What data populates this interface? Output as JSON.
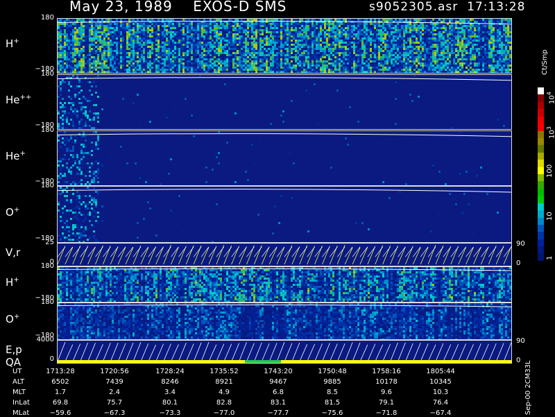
{
  "header": {
    "date": "May 23, 1989",
    "instrument": "EXOS-D SMS",
    "file": "s9052305.asr",
    "time": "17:13:28"
  },
  "chart_data": {
    "type": "heatmap",
    "panels": [
      {
        "label": "H",
        "sup": "+",
        "ymax": "180",
        "ymin": "−180",
        "intensity": 0.85
      },
      {
        "label": "He",
        "sup": "++",
        "ymax": "180",
        "ymin": "−180",
        "intensity": 0.0
      },
      {
        "label": "He",
        "sup": "+",
        "ymax": "180",
        "ymin": "−180",
        "intensity": 0.12
      },
      {
        "label": "O",
        "sup": "+",
        "ymax": "180",
        "ymin": "−180",
        "intensity": 0.1
      },
      {
        "label": "V,r",
        "sup": "",
        "ymax": "25",
        "ymin": "0",
        "right_top": "90",
        "right_bottom": "0",
        "kind": "trace"
      },
      {
        "label": "H",
        "sup": "+",
        "ymax": "180",
        "ymin": "−180",
        "intensity": 0.7
      },
      {
        "label": "O",
        "sup": "+",
        "ymax": "180",
        "ymin": "−180",
        "intensity": 0.45
      },
      {
        "label": "E,p",
        "label2": "QA",
        "sup": "",
        "ymax": "4000",
        "ymin": "0",
        "right_top": "90",
        "right_bottom": "0",
        "kind": "trace"
      }
    ],
    "colorbar": {
      "unit": "Ct/Smp",
      "ticks": [
        "10",
        "10",
        "100",
        "10",
        "1"
      ],
      "tick_exponents": [
        "4",
        "3",
        "",
        "",
        ""
      ],
      "colors": [
        "#ffffff",
        "#880000",
        "#aa0000",
        "#cc0000",
        "#ee0000",
        "#ff0000",
        "#887700",
        "#998800",
        "#667700",
        "#aaaa00",
        "#dddd00",
        "#ffff00",
        "#88bb00",
        "#33aa00",
        "#00bb00",
        "#00cc00",
        "#00cccc",
        "#00aacc",
        "#0088cc",
        "#0055bb",
        "#0033aa",
        "#002299",
        "#001a80",
        "#001570"
      ]
    }
  },
  "ephemeris": {
    "rows": [
      {
        "name": "UT",
        "values": [
          "1713:28",
          "1720:56",
          "1728:24",
          "1735:52",
          "1743:20",
          "1750:48",
          "1758:16",
          "1805:44"
        ]
      },
      {
        "name": "ALT",
        "values": [
          "6502",
          "7439",
          "8246",
          "8921",
          "9467",
          "9885",
          "10178",
          "10345"
        ]
      },
      {
        "name": "MLT",
        "values": [
          "1.7",
          "2.4",
          "3.4",
          "4.9",
          "6.8",
          "8.5",
          "9.6",
          "10.3"
        ]
      },
      {
        "name": "InLat",
        "values": [
          "69.8",
          "75.7",
          "80.1",
          "82.8",
          "83.1",
          "81.5",
          "79.1",
          "76.4"
        ]
      },
      {
        "name": "MLat",
        "values": [
          "−59.6",
          "−67.3",
          "−73.3",
          "−77.0",
          "−77.7",
          "−75.6",
          "−71.8",
          "−67.4"
        ]
      }
    ]
  },
  "footer": {
    "stamp": "Sep-00 2CM33L"
  },
  "colors": {
    "background": "#000000",
    "panel_fill": "#0a1a80",
    "trace": "#ffffff",
    "trace_yellow": "#ffff33",
    "qa_bar": "#ffff00",
    "qa_green": "#22cc44"
  }
}
